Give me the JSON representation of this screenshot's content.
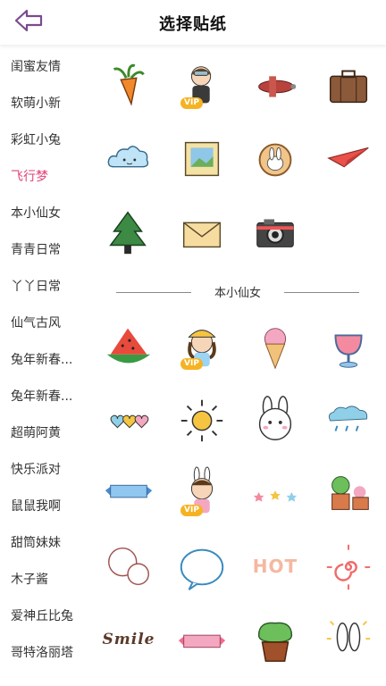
{
  "header": {
    "title": "选择贴纸",
    "back_icon": "back-arrow-icon",
    "accent": "#7a4a8e"
  },
  "sidebar": {
    "active_color": "#e0427a",
    "items": [
      {
        "label": "闺蜜友情",
        "active": false
      },
      {
        "label": "软萌小新",
        "active": false
      },
      {
        "label": "彩虹小兔",
        "active": false
      },
      {
        "label": "飞行梦",
        "active": true
      },
      {
        "label": "本小仙女",
        "active": false
      },
      {
        "label": "青青日常",
        "active": false
      },
      {
        "label": "丫丫日常",
        "active": false
      },
      {
        "label": "仙气古风",
        "active": false
      },
      {
        "label": "兔年新春...",
        "active": false
      },
      {
        "label": "兔年新春...",
        "active": false
      },
      {
        "label": "超萌阿黄",
        "active": false
      },
      {
        "label": "快乐派对",
        "active": false
      },
      {
        "label": "鼠鼠我啊",
        "active": false
      },
      {
        "label": "甜筒妹妹",
        "active": false
      },
      {
        "label": "木子酱",
        "active": false
      },
      {
        "label": "爱神丘比兔",
        "active": false
      },
      {
        "label": "哥特洛丽塔",
        "active": false
      }
    ]
  },
  "section_top": {
    "stickers": [
      {
        "icon": "carrot-icon",
        "vip": false
      },
      {
        "icon": "pilot-girl-icon",
        "vip": true,
        "vip_label": "VIP"
      },
      {
        "icon": "airplane-icon",
        "vip": false
      },
      {
        "icon": "suitcase-icon",
        "vip": false
      },
      {
        "icon": "cloud-icon",
        "vip": false
      },
      {
        "icon": "photo-frame-icon",
        "vip": false
      },
      {
        "icon": "bunny-cookie-icon",
        "vip": false
      },
      {
        "icon": "paper-plane-icon",
        "vip": false
      },
      {
        "icon": "tree-icon",
        "vip": false
      },
      {
        "icon": "envelope-icon",
        "vip": false
      },
      {
        "icon": "camera-icon",
        "vip": false
      }
    ]
  },
  "section_fairy": {
    "title": "本小仙女",
    "stickers": [
      {
        "icon": "watermelon-icon",
        "vip": false
      },
      {
        "icon": "girl-hat-icon",
        "vip": true,
        "vip_label": "VIP"
      },
      {
        "icon": "ice-cream-icon",
        "vip": false
      },
      {
        "icon": "drink-glass-icon",
        "vip": false
      },
      {
        "icon": "hearts-icon",
        "vip": false
      },
      {
        "icon": "sun-icon",
        "vip": false
      },
      {
        "icon": "bunny-face-icon",
        "vip": false
      },
      {
        "icon": "rain-cloud-icon",
        "vip": false
      },
      {
        "icon": "ribbon-banner-icon",
        "vip": false
      },
      {
        "icon": "bunny-girl-icon",
        "vip": true,
        "vip_label": "VIP"
      },
      {
        "icon": "stars-icon",
        "vip": false
      },
      {
        "icon": "potted-plants-icon",
        "vip": false
      },
      {
        "icon": "speech-bubbles-icon",
        "vip": false
      },
      {
        "icon": "round-bubble-icon",
        "vip": false
      },
      {
        "icon": "hot-text-icon",
        "vip": false,
        "text": "HOT"
      },
      {
        "icon": "swirl-sun-icon",
        "vip": false
      },
      {
        "icon": "smile-text-icon",
        "vip": false,
        "text": "Smile"
      },
      {
        "icon": "pink-ribbon-icon",
        "vip": false
      },
      {
        "icon": "potted-cactus-icon",
        "vip": false
      },
      {
        "icon": "bunny-ears-icon",
        "vip": false
      }
    ]
  }
}
